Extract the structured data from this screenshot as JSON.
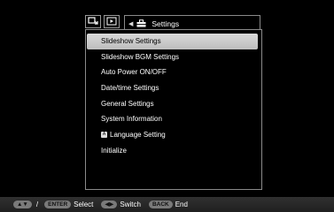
{
  "header": {
    "title": "Settings",
    "tabs": [
      {
        "icon": "slideshow-icon"
      },
      {
        "icon": "play-icon"
      }
    ]
  },
  "menu": {
    "items": [
      {
        "label": "Slideshow Settings",
        "selected": true
      },
      {
        "label": "Slideshow BGM Settings"
      },
      {
        "label": "Auto Power ON/OFF"
      },
      {
        "label": "Date/time Settings"
      },
      {
        "label": "General Settings"
      },
      {
        "label": "System Information"
      },
      {
        "label": "Language Setting",
        "badge": "A"
      },
      {
        "label": "Initialize"
      }
    ]
  },
  "footer": {
    "sep": "/",
    "enter_key": "ENTER",
    "select_label": "Select",
    "switch_label": "Switch",
    "back_key": "BACK",
    "end_label": "End"
  },
  "colors": {
    "selected_bg": "#c9c9c9",
    "border": "#8a8a8a"
  }
}
